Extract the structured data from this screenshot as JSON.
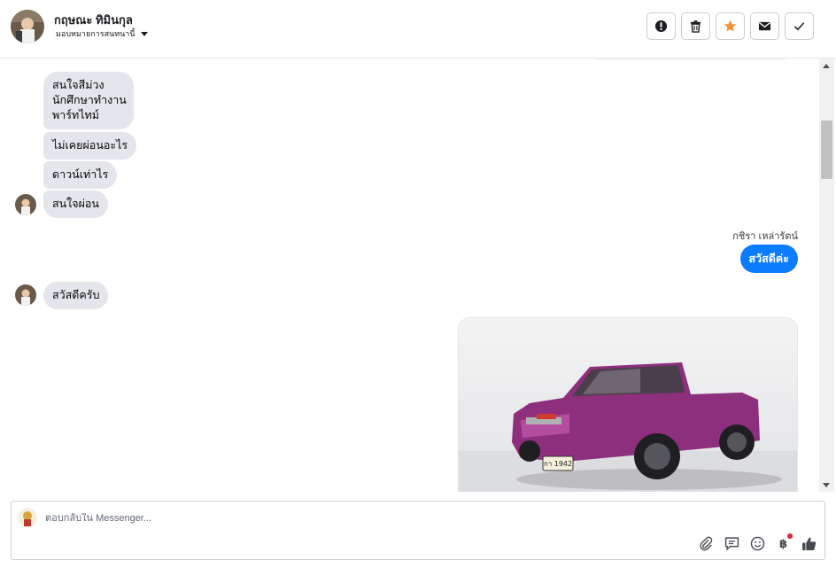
{
  "header": {
    "contact_name": "กฤษณะ ทิมินกุล",
    "assign_label": "มอบหมายการสนทนานี้",
    "actions": [
      {
        "name": "report-icon"
      },
      {
        "name": "trash-icon"
      },
      {
        "name": "star-icon",
        "color": "#f7923b"
      },
      {
        "name": "mail-icon"
      },
      {
        "name": "check-icon"
      }
    ]
  },
  "thread": {
    "incoming_group_1": {
      "bubble_1_lines": [
        "สนใจสีม่วง",
        "นักศึกษาทำงาน",
        "พาร์ทไทม์"
      ],
      "bubble_2": "ไม่เคยผ่อนอะไร",
      "bubble_3": "ดาวน์เท่าไร",
      "bubble_4": "สนใจผ่อน"
    },
    "outgoing": {
      "sender_name": "กชิรา เหล่ารัตน์",
      "message": "สวัสดีค่ะ",
      "bubble_color": "#0a7cff"
    },
    "incoming_group_2": {
      "message": "สวัสดีครับ"
    },
    "photo": {
      "plate_text": "กา 1942"
    }
  },
  "composer": {
    "placeholder": "ตอบกลับใน Messenger...",
    "tools": [
      "paperclip-icon",
      "saved-reply-icon",
      "emoji-icon",
      "payment-icon",
      "thumbs-up-icon"
    ],
    "payment_symbol": "฿"
  }
}
